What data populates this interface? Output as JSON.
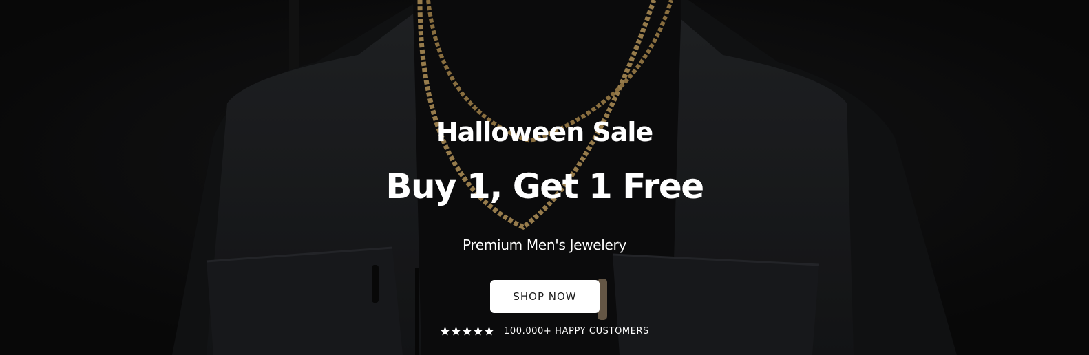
{
  "hero": {
    "eyebrow": "Halloween Sale",
    "headline": "Buy 1, Get 1 Free",
    "subtitle": "Premium Men's Jewelery",
    "cta_label": "SHOP NOW",
    "rating": {
      "stars": 5,
      "icon": "star-icon",
      "text": "100.000+ HAPPY CUSTOMERS"
    }
  },
  "colors": {
    "background": "#0d0d0d",
    "text": "#ffffff",
    "button_bg": "#ffffff",
    "button_text": "#1b1b1b",
    "chain": "#b8975c"
  }
}
